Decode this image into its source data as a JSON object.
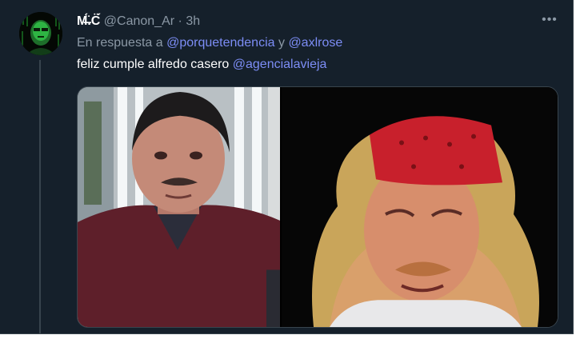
{
  "tweet": {
    "display_name": "M̶̈́.C̈́",
    "handle": "@Canon_Ar",
    "separator": "·",
    "time": "3h",
    "more_label": "•••",
    "reply_prefix": "En respuesta a",
    "reply_to_1": "@porquetendencia",
    "reply_joiner": "y",
    "reply_to_2": "@axlrose",
    "text": "feliz cumple alfredo casero",
    "mention": "@agencialavieja"
  },
  "colors": {
    "background": "#15202b",
    "link": "#7c8df5",
    "secondary_text": "#8b98a5",
    "primary_text": "#ffffff",
    "border": "#38444d"
  },
  "media": {
    "left_photo": "man-with-mustache-in-maroon-sweater",
    "right_photo": "man-with-red-bandana-and-blond-hair"
  }
}
